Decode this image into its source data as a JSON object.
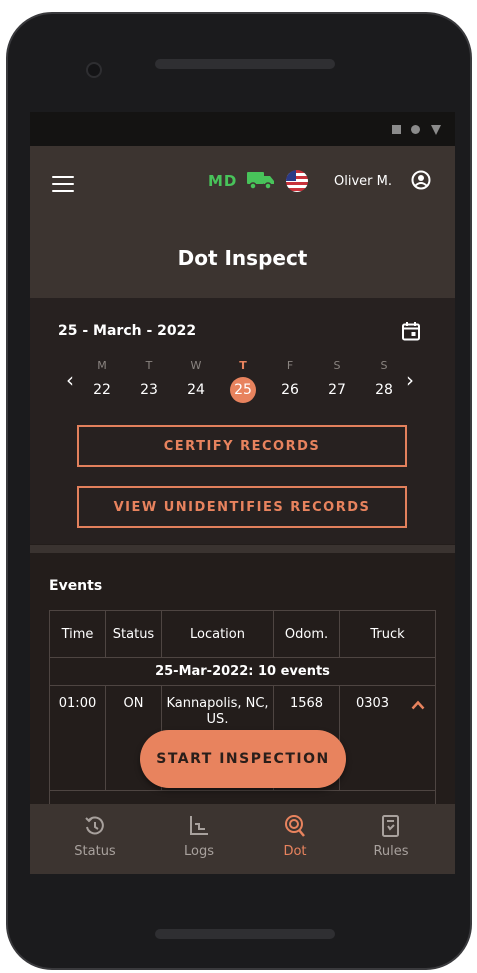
{
  "appbar": {
    "md_label": "MD",
    "user_name": "Oliver M.",
    "title": "Dot Inspect"
  },
  "date_selector": {
    "current_date": "25 - March - 2022",
    "days": [
      {
        "letter": "M",
        "number": "22",
        "active": false
      },
      {
        "letter": "T",
        "number": "23",
        "active": false
      },
      {
        "letter": "W",
        "number": "24",
        "active": false
      },
      {
        "letter": "T",
        "number": "25",
        "active": true
      },
      {
        "letter": "F",
        "number": "26",
        "active": false
      },
      {
        "letter": "S",
        "number": "27",
        "active": false
      },
      {
        "letter": "S",
        "number": "28",
        "active": false
      }
    ]
  },
  "buttons": {
    "certify": "CERTIFY RECORDS",
    "view_unidentified": "VIEW UNIDENTIFIES RECORDS",
    "start_inspection": "START INSPECTION"
  },
  "events": {
    "title": "Events",
    "columns": [
      "Time",
      "Status",
      "Location",
      "Odom.",
      "Truck"
    ],
    "group_header": "25-Mar-2022: 10 events",
    "rows": [
      {
        "time": "01:00",
        "status": "ON",
        "location": "Kannapolis, NC, US.",
        "odom": "1568",
        "truck": "0303"
      }
    ]
  },
  "bottom_nav": [
    {
      "label": "Status",
      "icon": "history-icon",
      "active": false
    },
    {
      "label": "Logs",
      "icon": "logs-chart-icon",
      "active": false
    },
    {
      "label": "Dot",
      "icon": "dot-inspect-icon",
      "active": true
    },
    {
      "label": "Rules",
      "icon": "rules-document-icon",
      "active": false
    }
  ],
  "colors": {
    "accent": "#e8835e",
    "md_green": "#48c35a",
    "appbar_bg": "#3c3430",
    "screen_bg": "#231d1b"
  }
}
